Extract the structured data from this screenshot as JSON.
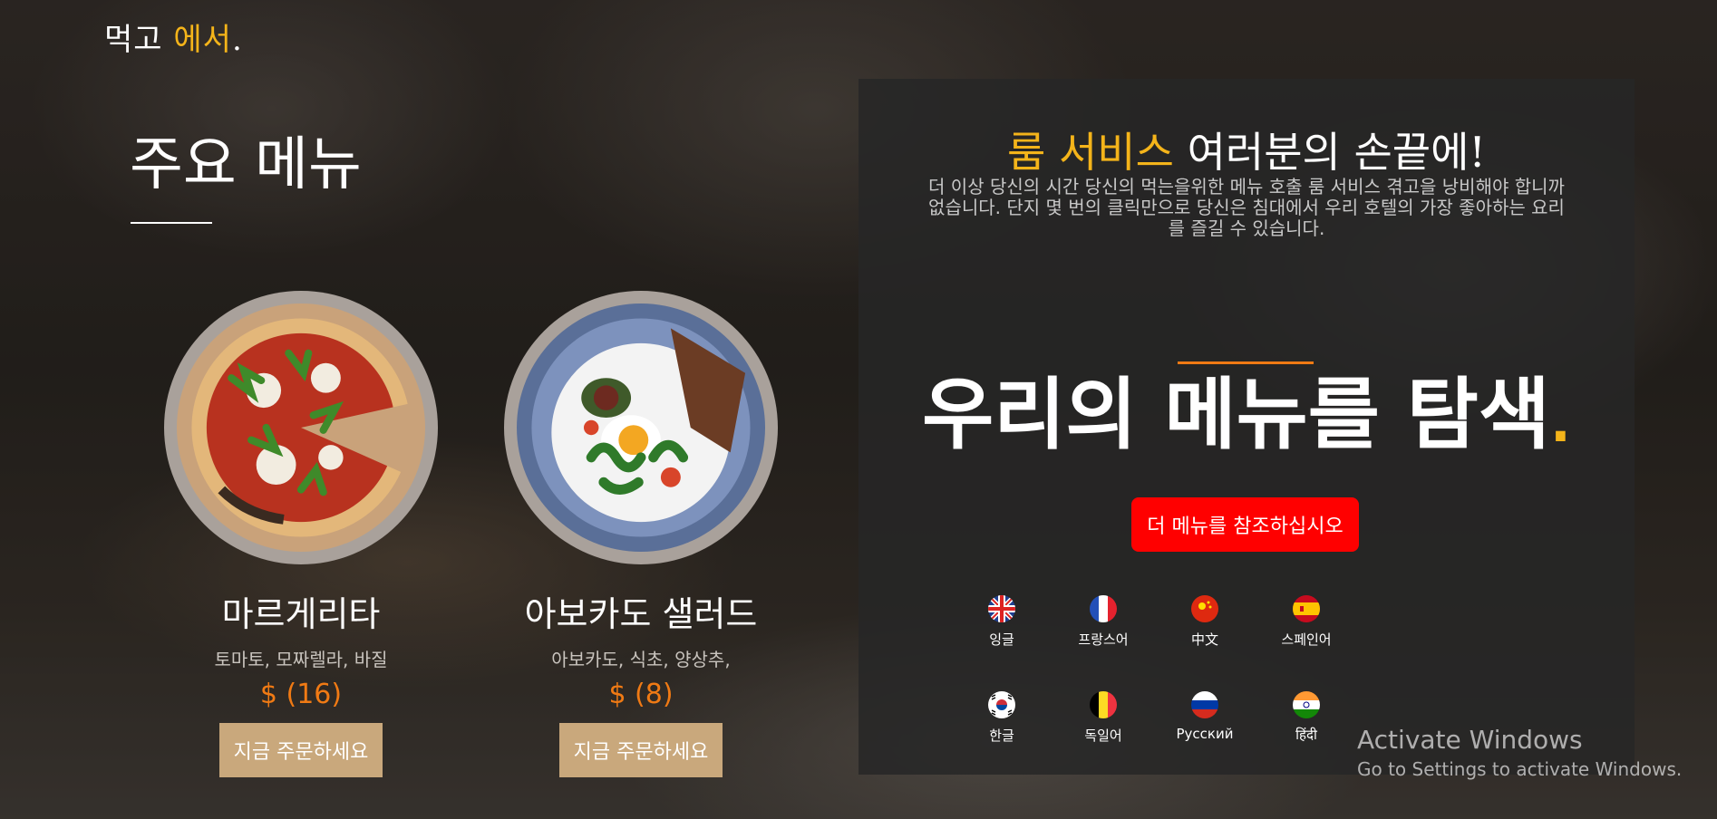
{
  "logo": {
    "part1": "먹고 ",
    "accent": "에서",
    "dot": "."
  },
  "menu": {
    "title": "주요 메뉴",
    "items": [
      {
        "name": "마르게리타",
        "desc": "토마토, 모짜렐라, 바질",
        "price": "$ (16)",
        "button": "지금 주문하세요"
      },
      {
        "name": "아보카도 샐러드",
        "desc": "아보카도, 식초, 양상추,",
        "price": "$ (8)",
        "button": "지금 주문하세요"
      }
    ]
  },
  "panel": {
    "heading_accent": "룸 서비스",
    "heading_rest": " 여러분의 손끝에!",
    "intro": "더 이상 당신의 시간 당신의 먹는을위한 메뉴 호출 룸 서비스 겪고을 낭비해야 합니까 없습니다. 단지 몇 번의 클릭만으로 당신은 침대에서 우리 호텔의 가장 좋아하는 요리를 즐길 수 있습니다.",
    "explore": "우리의 메뉴를 탐색",
    "explore_dot": ".",
    "cta": "더 메뉴를 참조하십시오",
    "languages": [
      "잉글",
      "프랑스어",
      "中文",
      "스페인어",
      "한글",
      "독일어",
      "Русский",
      "हिंदी"
    ]
  },
  "watermark": {
    "line1": "Activate Windows",
    "line2": "Go to Settings to activate Windows."
  },
  "colors": {
    "accent": "#f4b41a",
    "price": "#f07a14",
    "cta": "#ff0000",
    "order_button": "#c9a87c"
  }
}
